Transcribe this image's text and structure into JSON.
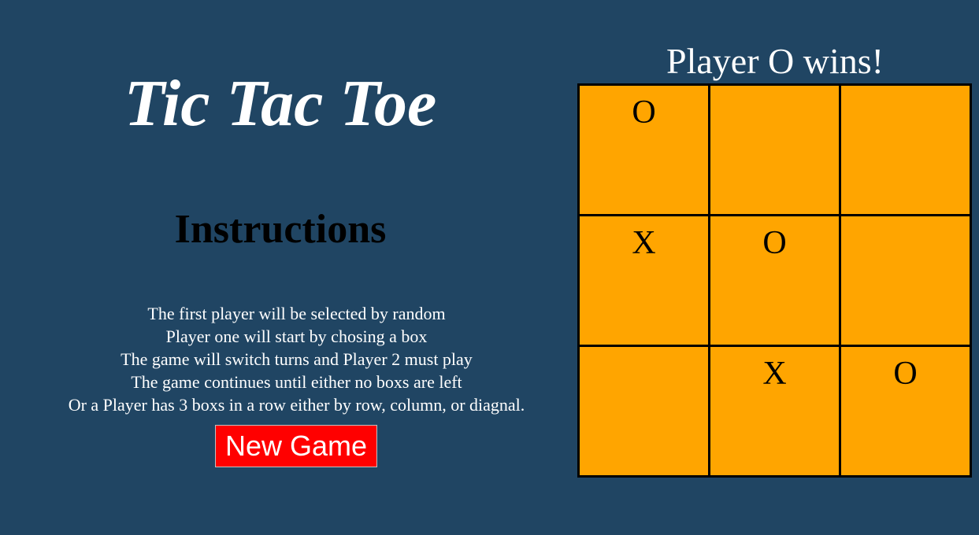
{
  "app": {
    "title": "Tic Tac Toe"
  },
  "instructions": {
    "heading": "Instructions",
    "lines": [
      "The first player will be selected by random",
      "Player one will start by chosing a box",
      "The game will switch turns and Player 2 must play",
      "The game continues until either no boxs are left",
      "Or a Player has 3 boxs in a row either by row, column, or diagnal."
    ]
  },
  "controls": {
    "new_game_label": "New Game"
  },
  "game": {
    "status": "Player O wins!",
    "board": [
      [
        "O",
        "",
        ""
      ],
      [
        "X",
        "O",
        ""
      ],
      [
        "",
        "X",
        "O"
      ]
    ]
  },
  "colors": {
    "background": "#204563",
    "cell": "#ffa500",
    "button": "#ff0000",
    "grid_lines": "#000000"
  }
}
